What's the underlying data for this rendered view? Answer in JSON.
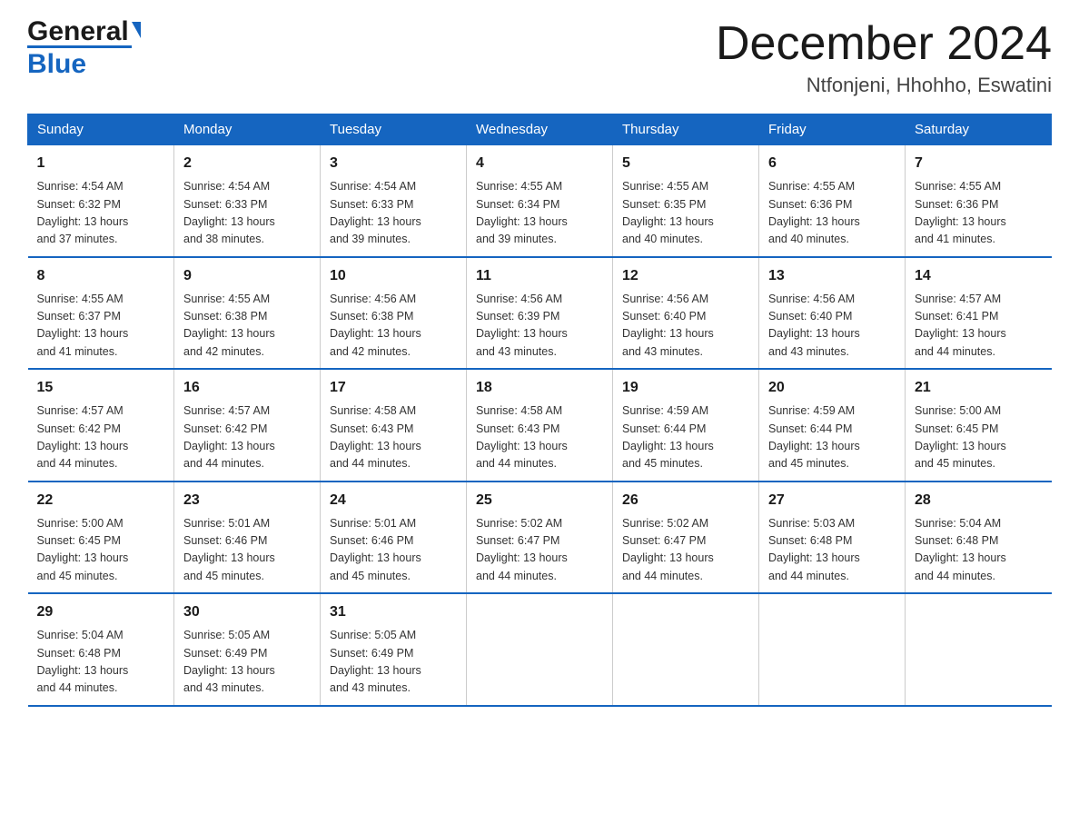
{
  "logo": {
    "general": "General",
    "triangle_decoration": "▶",
    "blue": "Blue"
  },
  "title": {
    "month": "December 2024",
    "location": "Ntfonjeni, Hhohho, Eswatini"
  },
  "headers": [
    "Sunday",
    "Monday",
    "Tuesday",
    "Wednesday",
    "Thursday",
    "Friday",
    "Saturday"
  ],
  "weeks": [
    [
      {
        "day": "1",
        "info": "Sunrise: 4:54 AM\nSunset: 6:32 PM\nDaylight: 13 hours\nand 37 minutes."
      },
      {
        "day": "2",
        "info": "Sunrise: 4:54 AM\nSunset: 6:33 PM\nDaylight: 13 hours\nand 38 minutes."
      },
      {
        "day": "3",
        "info": "Sunrise: 4:54 AM\nSunset: 6:33 PM\nDaylight: 13 hours\nand 39 minutes."
      },
      {
        "day": "4",
        "info": "Sunrise: 4:55 AM\nSunset: 6:34 PM\nDaylight: 13 hours\nand 39 minutes."
      },
      {
        "day": "5",
        "info": "Sunrise: 4:55 AM\nSunset: 6:35 PM\nDaylight: 13 hours\nand 40 minutes."
      },
      {
        "day": "6",
        "info": "Sunrise: 4:55 AM\nSunset: 6:36 PM\nDaylight: 13 hours\nand 40 minutes."
      },
      {
        "day": "7",
        "info": "Sunrise: 4:55 AM\nSunset: 6:36 PM\nDaylight: 13 hours\nand 41 minutes."
      }
    ],
    [
      {
        "day": "8",
        "info": "Sunrise: 4:55 AM\nSunset: 6:37 PM\nDaylight: 13 hours\nand 41 minutes."
      },
      {
        "day": "9",
        "info": "Sunrise: 4:55 AM\nSunset: 6:38 PM\nDaylight: 13 hours\nand 42 minutes."
      },
      {
        "day": "10",
        "info": "Sunrise: 4:56 AM\nSunset: 6:38 PM\nDaylight: 13 hours\nand 42 minutes."
      },
      {
        "day": "11",
        "info": "Sunrise: 4:56 AM\nSunset: 6:39 PM\nDaylight: 13 hours\nand 43 minutes."
      },
      {
        "day": "12",
        "info": "Sunrise: 4:56 AM\nSunset: 6:40 PM\nDaylight: 13 hours\nand 43 minutes."
      },
      {
        "day": "13",
        "info": "Sunrise: 4:56 AM\nSunset: 6:40 PM\nDaylight: 13 hours\nand 43 minutes."
      },
      {
        "day": "14",
        "info": "Sunrise: 4:57 AM\nSunset: 6:41 PM\nDaylight: 13 hours\nand 44 minutes."
      }
    ],
    [
      {
        "day": "15",
        "info": "Sunrise: 4:57 AM\nSunset: 6:42 PM\nDaylight: 13 hours\nand 44 minutes."
      },
      {
        "day": "16",
        "info": "Sunrise: 4:57 AM\nSunset: 6:42 PM\nDaylight: 13 hours\nand 44 minutes."
      },
      {
        "day": "17",
        "info": "Sunrise: 4:58 AM\nSunset: 6:43 PM\nDaylight: 13 hours\nand 44 minutes."
      },
      {
        "day": "18",
        "info": "Sunrise: 4:58 AM\nSunset: 6:43 PM\nDaylight: 13 hours\nand 44 minutes."
      },
      {
        "day": "19",
        "info": "Sunrise: 4:59 AM\nSunset: 6:44 PM\nDaylight: 13 hours\nand 45 minutes."
      },
      {
        "day": "20",
        "info": "Sunrise: 4:59 AM\nSunset: 6:44 PM\nDaylight: 13 hours\nand 45 minutes."
      },
      {
        "day": "21",
        "info": "Sunrise: 5:00 AM\nSunset: 6:45 PM\nDaylight: 13 hours\nand 45 minutes."
      }
    ],
    [
      {
        "day": "22",
        "info": "Sunrise: 5:00 AM\nSunset: 6:45 PM\nDaylight: 13 hours\nand 45 minutes."
      },
      {
        "day": "23",
        "info": "Sunrise: 5:01 AM\nSunset: 6:46 PM\nDaylight: 13 hours\nand 45 minutes."
      },
      {
        "day": "24",
        "info": "Sunrise: 5:01 AM\nSunset: 6:46 PM\nDaylight: 13 hours\nand 45 minutes."
      },
      {
        "day": "25",
        "info": "Sunrise: 5:02 AM\nSunset: 6:47 PM\nDaylight: 13 hours\nand 44 minutes."
      },
      {
        "day": "26",
        "info": "Sunrise: 5:02 AM\nSunset: 6:47 PM\nDaylight: 13 hours\nand 44 minutes."
      },
      {
        "day": "27",
        "info": "Sunrise: 5:03 AM\nSunset: 6:48 PM\nDaylight: 13 hours\nand 44 minutes."
      },
      {
        "day": "28",
        "info": "Sunrise: 5:04 AM\nSunset: 6:48 PM\nDaylight: 13 hours\nand 44 minutes."
      }
    ],
    [
      {
        "day": "29",
        "info": "Sunrise: 5:04 AM\nSunset: 6:48 PM\nDaylight: 13 hours\nand 44 minutes."
      },
      {
        "day": "30",
        "info": "Sunrise: 5:05 AM\nSunset: 6:49 PM\nDaylight: 13 hours\nand 43 minutes."
      },
      {
        "day": "31",
        "info": "Sunrise: 5:05 AM\nSunset: 6:49 PM\nDaylight: 13 hours\nand 43 minutes."
      },
      {
        "day": "",
        "info": ""
      },
      {
        "day": "",
        "info": ""
      },
      {
        "day": "",
        "info": ""
      },
      {
        "day": "",
        "info": ""
      }
    ]
  ]
}
